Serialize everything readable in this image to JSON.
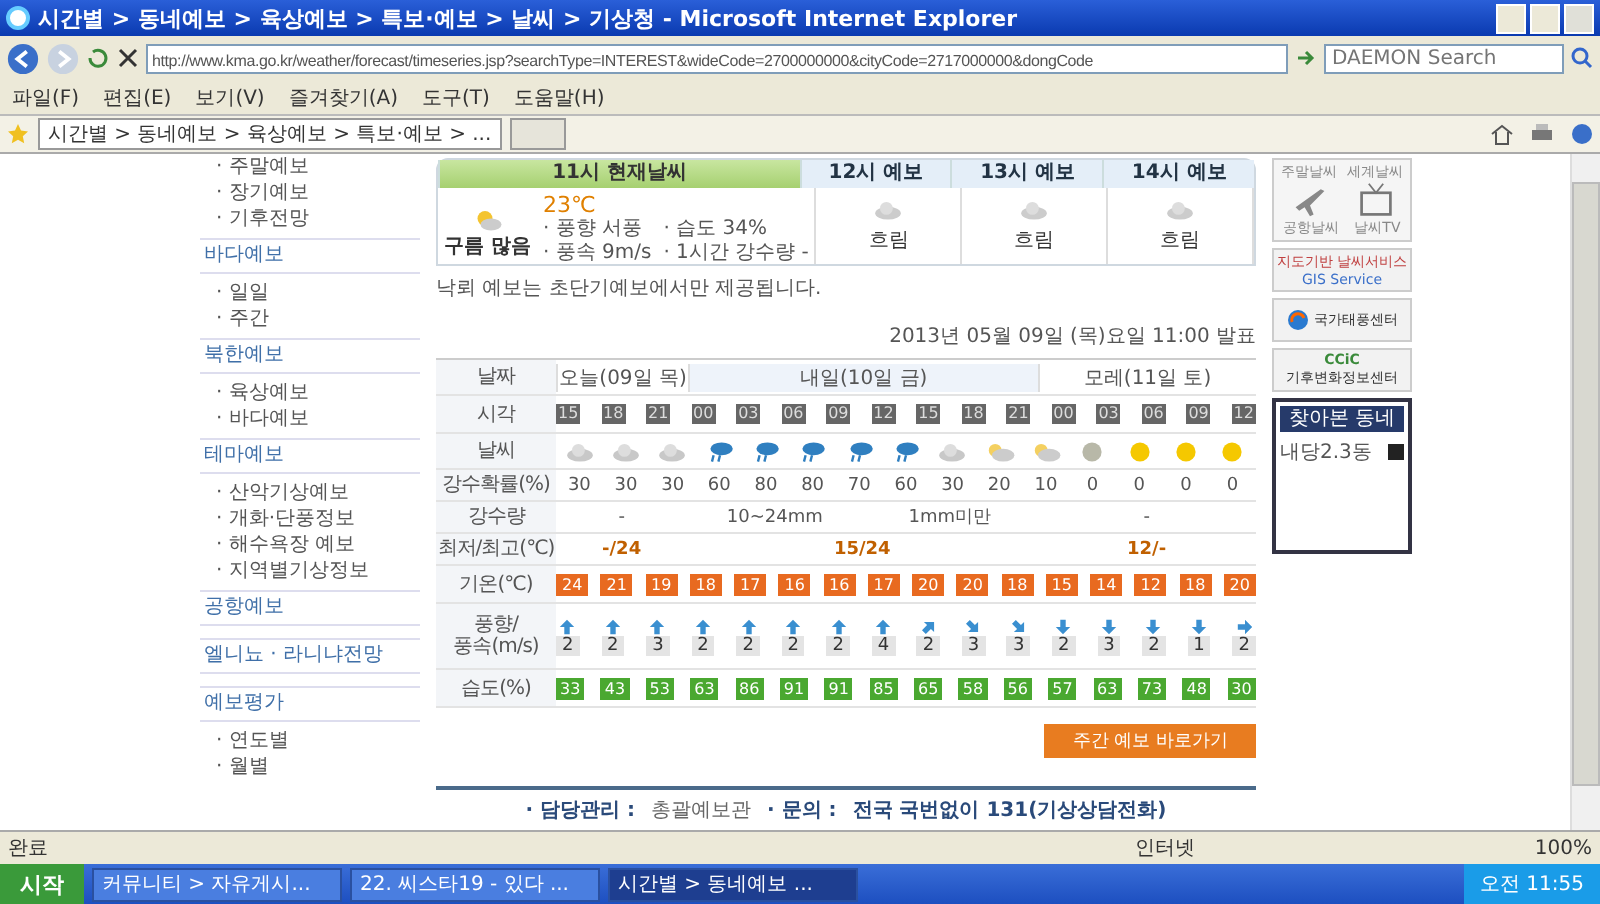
{
  "window": {
    "title": "시간별 > 동네예보 > 육상예보 > 특보·예보 > 날씨 > 기상청 - Microsoft Internet Explorer"
  },
  "address_bar": {
    "url": "http://www.kma.go.kr/weather/forecast/timeseries.jsp?searchType=INTEREST&wideCode=2700000000&cityCode=2717000000&dongCode",
    "search_placeholder": "DAEMON Search"
  },
  "menu": [
    "파일(F)",
    "편집(E)",
    "보기(V)",
    "즐겨찾기(A)",
    "도구(T)",
    "도움말(H)"
  ],
  "tab": {
    "title": "시간별 > 동네예보 > 육상예보 > 특보·예보 > ..."
  },
  "sidebar": [
    {
      "kind": "item",
      "label": "· 주말예보"
    },
    {
      "kind": "item",
      "label": "· 장기예보"
    },
    {
      "kind": "item",
      "label": "· 기후전망"
    },
    {
      "kind": "header",
      "label": "바다예보"
    },
    {
      "kind": "item",
      "label": "· 일일"
    },
    {
      "kind": "item",
      "label": "· 주간"
    },
    {
      "kind": "header",
      "label": "북한예보"
    },
    {
      "kind": "item",
      "label": "· 육상예보"
    },
    {
      "kind": "item",
      "label": "· 바다예보"
    },
    {
      "kind": "header",
      "label": "테마예보"
    },
    {
      "kind": "item",
      "label": "· 산악기상예보"
    },
    {
      "kind": "item",
      "label": "· 개화·단풍정보"
    },
    {
      "kind": "item",
      "label": "· 해수욕장 예보"
    },
    {
      "kind": "item",
      "label": "· 지역별기상정보"
    },
    {
      "kind": "header",
      "label": "공항예보"
    },
    {
      "kind": "header",
      "label": "엘니뇨 · 라니냐전망"
    },
    {
      "kind": "header",
      "label": "예보평가"
    },
    {
      "kind": "item",
      "label": "· 연도별"
    },
    {
      "kind": "item",
      "label": "· 월별"
    }
  ],
  "now_tabs": [
    {
      "label": "11시 현재날씨",
      "selected": true
    },
    {
      "label": "12시 예보",
      "selected": false
    },
    {
      "label": "13시 예보",
      "selected": false
    },
    {
      "label": "14시 예보",
      "selected": false
    }
  ],
  "current": {
    "sky": "구름 많음",
    "temp": "23℃",
    "details": [
      "· 풍향 서풍",
      "· 습도 34%",
      "· 풍속 9m/s",
      "· 1시간 강수량 -"
    ]
  },
  "hourly": [
    {
      "sky": "흐림"
    },
    {
      "sky": "흐림"
    },
    {
      "sky": "흐림"
    }
  ],
  "note": "낙뢰 예보는 초단기예보에서만 제공됩니다.",
  "issued": "2013년 05월 09일 (목)요일 11:00 발표",
  "table": {
    "labels": [
      "날짜",
      "시각",
      "날씨",
      "강수확률(%)",
      "강수량",
      "최저/최고(℃)",
      "기온(℃)",
      "풍향/\n풍속(m/s)",
      "습도(%)"
    ],
    "days": [
      {
        "label": "오늘(09일 목)",
        "selected": false
      },
      {
        "label": "내일(10일 금)",
        "selected": true
      },
      {
        "label": "모레(11일 토)",
        "selected": false
      }
    ],
    "times": [
      "15",
      "18",
      "21",
      "00",
      "03",
      "06",
      "09",
      "12",
      "15",
      "18",
      "21",
      "00",
      "03",
      "06",
      "09",
      "12"
    ],
    "weather": [
      {
        "kind": "cloudy"
      },
      {
        "kind": "cloudy"
      },
      {
        "kind": "cloudy"
      },
      {
        "kind": "rain"
      },
      {
        "kind": "rain"
      },
      {
        "kind": "rain"
      },
      {
        "kind": "rain"
      },
      {
        "kind": "rain"
      },
      {
        "kind": "cloudy"
      },
      {
        "kind": "partly"
      },
      {
        "kind": "partly"
      },
      {
        "kind": "overcast"
      },
      {
        "kind": "sunny"
      },
      {
        "kind": "sunny"
      },
      {
        "kind": "sunny"
      }
    ],
    "precip_prob": [
      "30",
      "30",
      "30",
      "60",
      "80",
      "80",
      "70",
      "60",
      "30",
      "20",
      "10",
      "0",
      "0",
      "0",
      "0"
    ],
    "precip_amount": [
      "-",
      "10~24mm",
      "1mm미만",
      "-"
    ],
    "min_max": [
      "-/24",
      "15/24",
      "12/-"
    ],
    "temps": [
      "24",
      "21",
      "19",
      "18",
      "17",
      "16",
      "16",
      "17",
      "20",
      "20",
      "18",
      "15",
      "14",
      "12",
      "18",
      "20"
    ],
    "wind": [
      {
        "kind": "n",
        "speed": "2"
      },
      {
        "kind": "n",
        "speed": "2"
      },
      {
        "kind": "n",
        "speed": "3"
      },
      {
        "kind": "n",
        "speed": "2"
      },
      {
        "kind": "n",
        "speed": "2"
      },
      {
        "kind": "n",
        "speed": "2"
      },
      {
        "kind": "n",
        "speed": "2"
      },
      {
        "kind": "n",
        "speed": "4"
      },
      {
        "kind": "ne",
        "speed": "2"
      },
      {
        "kind": "se",
        "speed": "3"
      },
      {
        "kind": "se",
        "speed": "3"
      },
      {
        "kind": "s",
        "speed": "2"
      },
      {
        "kind": "s",
        "speed": "3"
      },
      {
        "kind": "s",
        "speed": "2"
      },
      {
        "kind": "s",
        "speed": "1"
      },
      {
        "kind": "e",
        "speed": "2"
      }
    ],
    "humidity": [
      "33",
      "43",
      "53",
      "63",
      "86",
      "91",
      "91",
      "85",
      "65",
      "58",
      "56",
      "57",
      "63",
      "73",
      "48",
      "30"
    ]
  },
  "weekly_button": "주간 예보 바로가기",
  "footer": {
    "manager_label": "· 담당관리 :",
    "manager": "총괄예보관",
    "contact_label": "· 문의 :",
    "contact": "전국 국번없이 131(기상상담전화)"
  },
  "right": {
    "top_labels": [
      "주말날씨",
      "세계날씨"
    ],
    "icons": [
      "공항날씨",
      "날씨TV"
    ],
    "gis": "지도기반 날씨서비스",
    "gis_en": "GIS Service",
    "typhoon": "국가태풍센터",
    "ccic": "CCiC",
    "ccic_name": "기후변화정보센터",
    "recent_title": "찾아본 동네",
    "recent": [
      "내당2.3동"
    ]
  },
  "status": {
    "text": "완료",
    "zone": "인터넷",
    "zoom": "100%"
  },
  "taskbar": {
    "start": "시작",
    "items": [
      {
        "label": "커뮤니티 > 자유게시...",
        "selected": false
      },
      {
        "label": "22. 씨스타19 - 있다 ...",
        "selected": false
      },
      {
        "label": "시간별 > 동네예보 ...",
        "selected": true
      }
    ],
    "clock": "오전 11:55"
  }
}
